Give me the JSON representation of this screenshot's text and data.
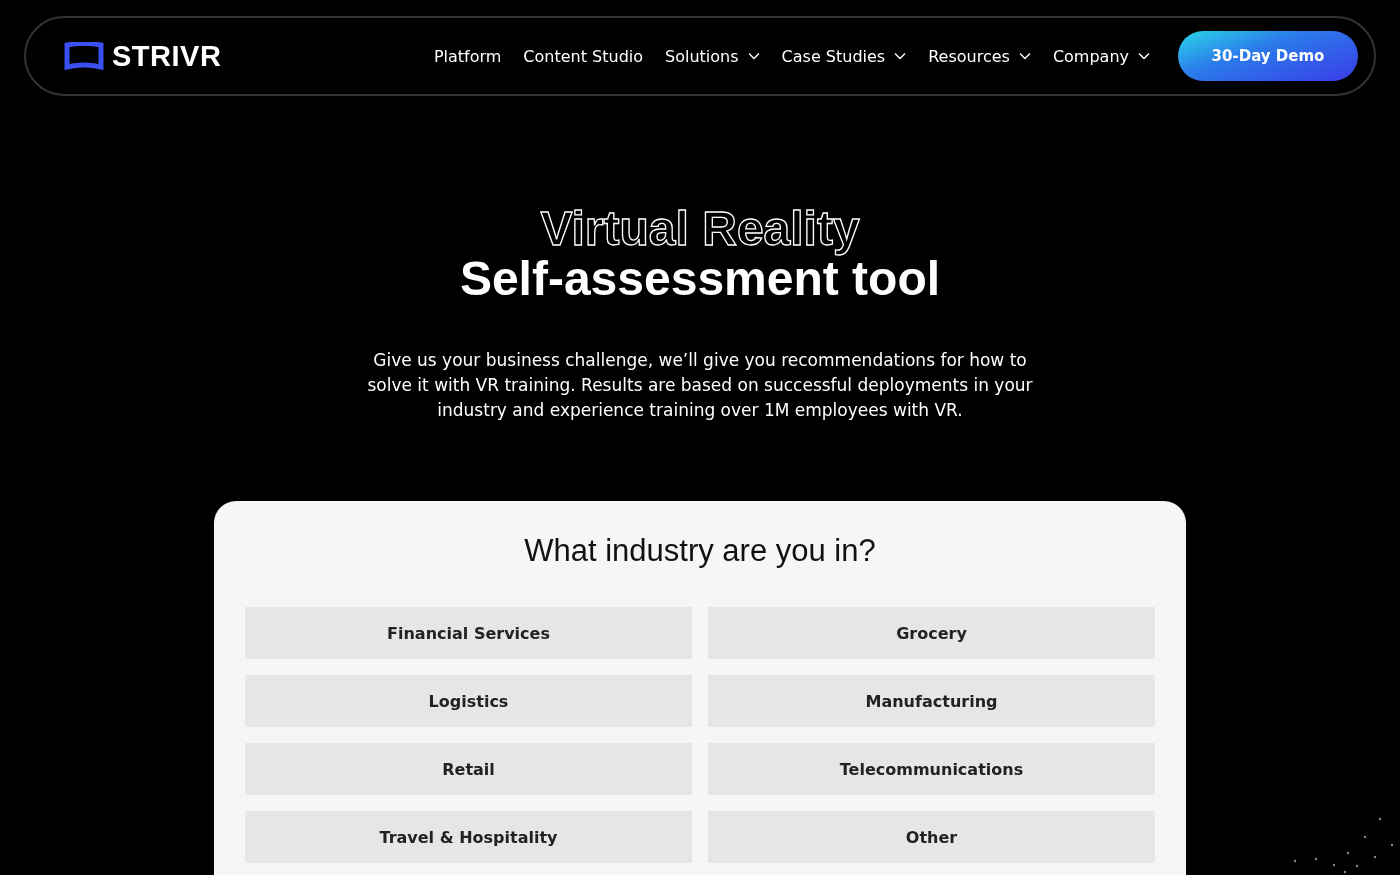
{
  "brand": {
    "name": "STRIVR"
  },
  "nav": [
    {
      "label": "Platform",
      "has_menu": false
    },
    {
      "label": "Content Studio",
      "has_menu": false
    },
    {
      "label": "Solutions",
      "has_menu": true
    },
    {
      "label": "Case Studies",
      "has_menu": true
    },
    {
      "label": "Resources",
      "has_menu": true
    },
    {
      "label": "Company",
      "has_menu": true
    }
  ],
  "cta": "30-Day Demo",
  "hero": {
    "eyebrow": "Virtual Reality",
    "title": "Self-assessment tool",
    "intro": "Give us your business challenge, we’ll give you recommendations for how to solve it with VR training. Results are based on successful deployments in your industry and experience training over 1M employees with VR."
  },
  "question": {
    "title": "What industry are you in?",
    "options": [
      "Financial Services",
      "Grocery",
      "Logistics",
      "Manufacturing",
      "Retail",
      "Telecommunications",
      "Travel & Hospitality",
      "Other"
    ]
  }
}
